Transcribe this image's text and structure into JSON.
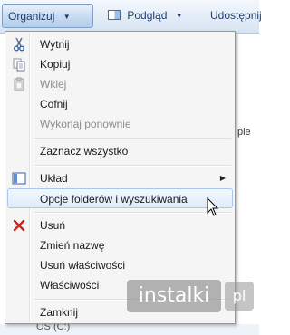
{
  "toolbar": {
    "organize": "Organizuj",
    "preview": "Podgląd",
    "share": "Udostępnij"
  },
  "background": {
    "right_fragment": "pie",
    "drive_label": "OS (C:)"
  },
  "menu": {
    "items": [
      {
        "label": "Wytnij",
        "icon": "scissors-icon",
        "disabled": false
      },
      {
        "label": "Kopiuj",
        "icon": "copy-icon",
        "disabled": false
      },
      {
        "label": "Wklej",
        "icon": "paste-icon",
        "disabled": true
      },
      {
        "label": "Cofnij",
        "icon": "",
        "disabled": false
      },
      {
        "label": "Wykonaj ponownie",
        "icon": "",
        "disabled": true
      },
      {
        "label": "Zaznacz wszystko",
        "icon": "",
        "disabled": false
      },
      {
        "label": "Układ",
        "icon": "layout-icon",
        "disabled": false,
        "submenu": true
      },
      {
        "label": "Opcje folderów i wyszukiwania",
        "icon": "",
        "disabled": false,
        "highlighted": true
      },
      {
        "label": "Usuń",
        "icon": "delete-x-icon",
        "disabled": false
      },
      {
        "label": "Zmień nazwę",
        "icon": "",
        "disabled": false
      },
      {
        "label": "Usuń właściwości",
        "icon": "",
        "disabled": false
      },
      {
        "label": "Właściwości",
        "icon": "",
        "disabled": false
      },
      {
        "label": "Zamknij",
        "icon": "",
        "disabled": false
      }
    ]
  },
  "watermark": {
    "text": "instalki",
    "badge": "pl"
  },
  "colors": {
    "delete_icon": "#d02020",
    "highlight_border": "#a8c7ea",
    "disabled_text": "#8d8d8d"
  }
}
